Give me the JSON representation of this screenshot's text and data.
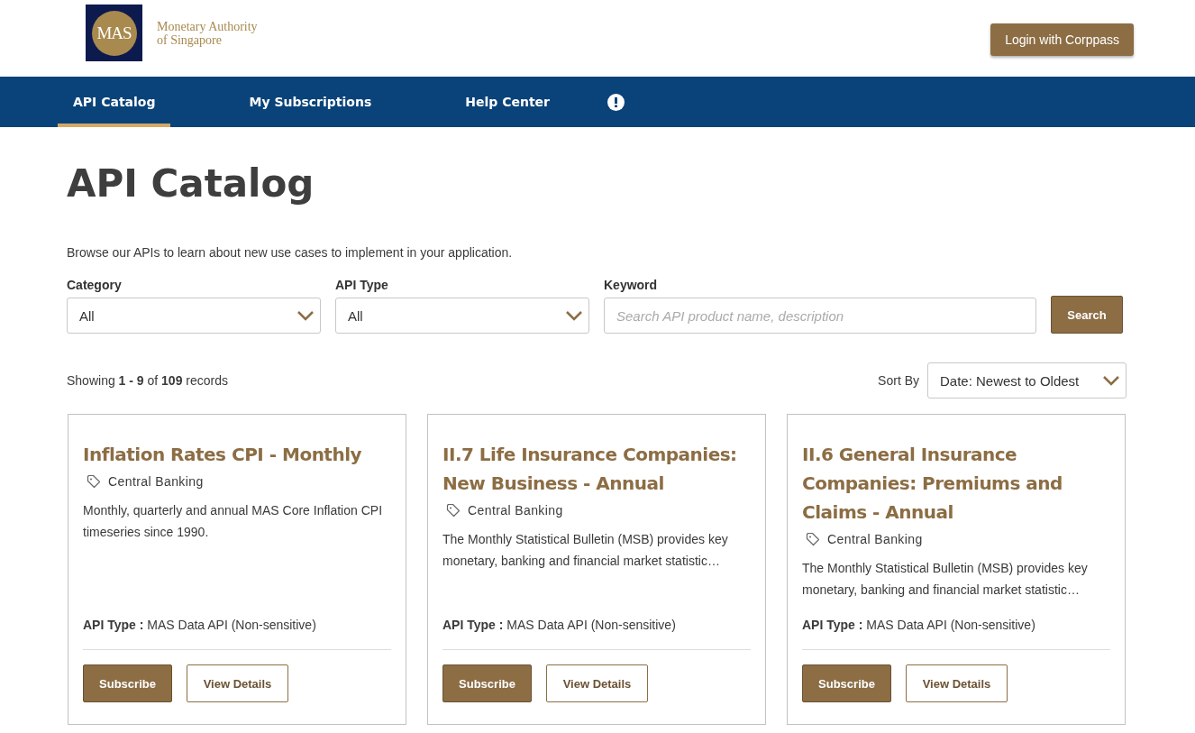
{
  "header": {
    "logo_mark": "MAS",
    "logo_text": [
      "Monetary Authority",
      "of Singapore"
    ],
    "login_button": "Login with Corppass"
  },
  "nav": {
    "tabs": [
      {
        "label": "API Catalog",
        "selected": true
      },
      {
        "label": "My Subscriptions",
        "selected": false
      },
      {
        "label": "Help Center",
        "selected": false
      }
    ]
  },
  "page": {
    "title": "API Catalog",
    "description": "Browse our APIs to learn about new use cases to implement in your application."
  },
  "filters": {
    "category": {
      "label": "Category",
      "value": "All"
    },
    "api_type": {
      "label": "API Type",
      "value": "All"
    },
    "keyword": {
      "label": "Keyword",
      "placeholder": "Search API product name, description"
    },
    "search_button": "Search"
  },
  "results": {
    "summary": "Showing **1 - 9** of **109** records",
    "sort_label": "Sort By",
    "sort_value": "Date: Newest to Oldest"
  },
  "cards": [
    {
      "title": "Inflation Rates CPI - Monthly",
      "tag": "Central Banking",
      "description": "Monthly, quarterly and annual MAS Core Inflation CPI timeseries since 1990.",
      "api_type_label": "API Type :",
      "api_type": "MAS Data API (Non-sensitive)",
      "subscribe": "Subscribe",
      "details": "View Details"
    },
    {
      "title": "II.7 Life Insurance Companies: New Business - Annual",
      "tag": "Central Banking",
      "description": "The Monthly Statistical Bulletin (MSB) provides key monetary, banking and financial market statistic…",
      "api_type_label": "API Type :",
      "api_type": "MAS Data API (Non-sensitive)",
      "subscribe": "Subscribe",
      "details": "View Details"
    },
    {
      "title": "II.6 General Insurance Companies: Premiums and Claims - Annual",
      "tag": "Central Banking",
      "description": "The Monthly Statistical Bulletin (MSB) provides key monetary, banking and financial market statistic…",
      "api_type_label": "API Type :",
      "api_type": "MAS Data API (Non-sensitive)",
      "subscribe": "Subscribe",
      "details": "View Details"
    }
  ]
}
